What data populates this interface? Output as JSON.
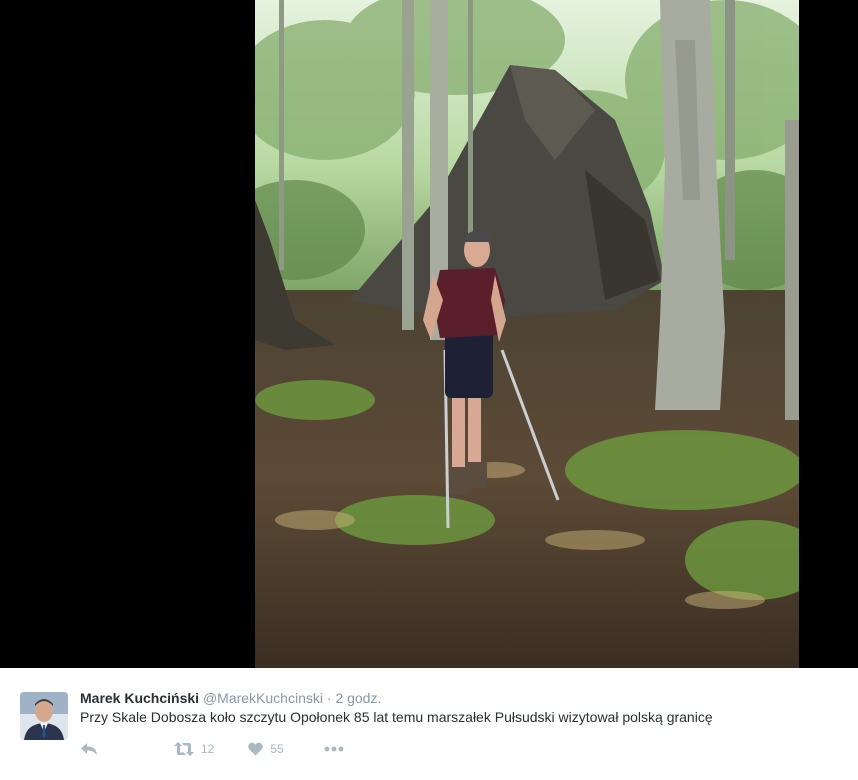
{
  "tweet": {
    "author_name": "Marek Kuchciński",
    "author_handle": "@MarekKuchcinski",
    "separator": "·",
    "timestamp": "2 godz.",
    "text": "Przy Skale Dobosza koło szczytu Opołonek 85 lat temu marszałek Pułsudski wizytował polską granicę",
    "actions": {
      "reply_icon": "reply-icon",
      "retweet_icon": "retweet-icon",
      "retweet_count": "12",
      "like_icon": "heart-icon",
      "like_count": "55",
      "more_icon": "more-icon"
    }
  },
  "media": {
    "type": "photo",
    "colors": {
      "letterbox": "#000000"
    }
  }
}
